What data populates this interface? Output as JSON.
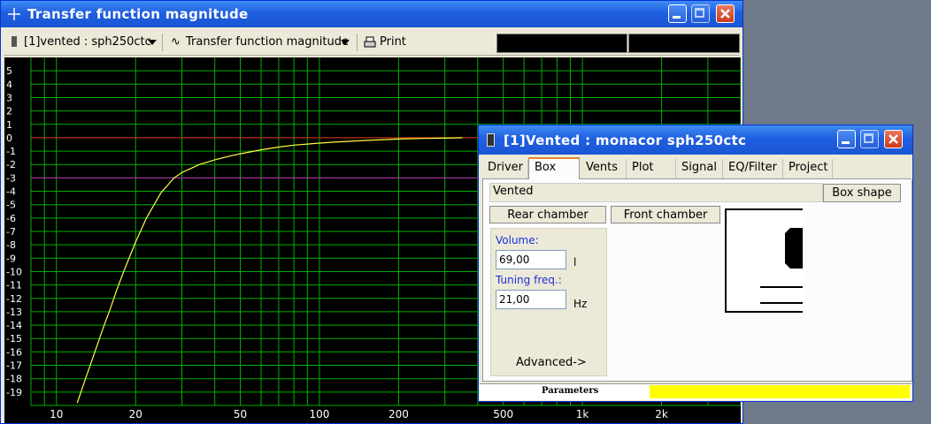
{
  "main_window": {
    "title": "Transfer function magnitude",
    "toolbar": {
      "project_select": "[1]vented : sph250ctc",
      "plot_select": "Transfer function magnitude",
      "print_label": "Print"
    }
  },
  "dialog": {
    "title": "[1]Vented : monacor sph250ctc",
    "tabs": [
      "Driver",
      "Box",
      "Vents",
      "Plot",
      "Signal",
      "EQ/Filter",
      "Project"
    ],
    "active_tab": "Box",
    "box_type": "Vented",
    "box_shape_label": "Box shape",
    "rear_chamber_label": "Rear chamber",
    "front_chamber_label": "Front chamber",
    "volume_label": "Volume:",
    "volume_value": "69,00",
    "volume_unit": "l",
    "tuning_label": "Tuning freq.:",
    "tuning_value": "21,00",
    "tuning_unit": "Hz",
    "advanced_label": "Advanced->",
    "status_label": "Parameters",
    "status_color": "#ffff00"
  },
  "chart_data": {
    "type": "line",
    "x_scale": "log",
    "xlim": [
      8,
      4000
    ],
    "ylim": [
      -20,
      6
    ],
    "x_ticks": [
      10,
      20,
      50,
      100,
      200,
      500,
      1000,
      2000
    ],
    "x_tick_labels": [
      "10",
      "20",
      "50",
      "100",
      "200",
      "500",
      "1k",
      "2k"
    ],
    "y_ticks": [
      5,
      4,
      3,
      2,
      1,
      0,
      -1,
      -2,
      -3,
      -4,
      -5,
      -6,
      -7,
      -8,
      -9,
      -10,
      -11,
      -12,
      -13,
      -14,
      -15,
      -16,
      -17,
      -18,
      -19
    ],
    "reference_lines": [
      {
        "y": 0,
        "color": "#e02020"
      },
      {
        "y": -3,
        "color": "#c020c0"
      }
    ],
    "grid": true,
    "background": "#000000",
    "grid_color": "#00b000",
    "curve_color": "#ffff40",
    "series": [
      {
        "x": [
          12,
          13,
          14,
          15,
          16,
          17,
          18,
          20,
          22,
          25,
          28,
          30,
          35,
          40,
          45,
          50,
          60,
          70,
          80,
          100,
          120,
          150,
          200,
          250,
          300,
          350
        ],
        "y": [
          -19.8,
          -17.8,
          -16.0,
          -14.3,
          -12.8,
          -11.3,
          -10.0,
          -7.8,
          -6.0,
          -4.1,
          -3.0,
          -2.6,
          -2.0,
          -1.65,
          -1.4,
          -1.2,
          -0.9,
          -0.7,
          -0.55,
          -0.4,
          -0.3,
          -0.2,
          -0.1,
          -0.05,
          -0.03,
          0.0
        ]
      }
    ]
  }
}
